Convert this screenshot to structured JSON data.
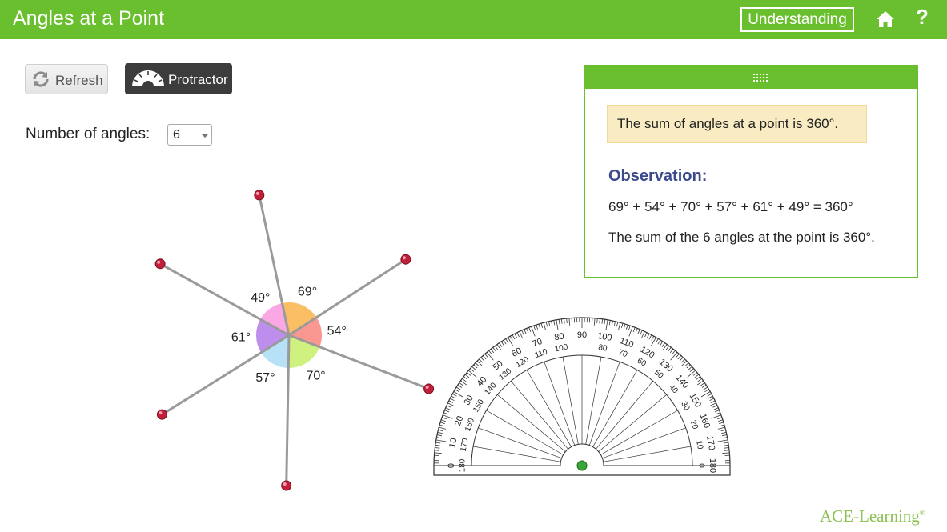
{
  "header": {
    "title": "Angles at a Point",
    "understanding_label": "Understanding",
    "home_icon": "home-icon",
    "help_label": "?"
  },
  "toolbar": {
    "refresh_label": "Refresh",
    "protractor_label": "Protractor"
  },
  "controls": {
    "num_angles_label": "Number of angles:",
    "num_angles_value": "6"
  },
  "diagram": {
    "angles": [
      {
        "label": "69°",
        "value": 69,
        "color": "#f9b44a"
      },
      {
        "label": "54°",
        "value": 54,
        "color": "#f8857e"
      },
      {
        "label": "70°",
        "value": 70,
        "color": "#c5ef6a"
      },
      {
        "label": "57°",
        "value": 57,
        "color": "#a9dcf5"
      },
      {
        "label": "61°",
        "value": 61,
        "color": "#b27ae8"
      },
      {
        "label": "49°",
        "value": 49,
        "color": "#f999df"
      }
    ]
  },
  "observation": {
    "fact": "The sum of angles at a point is 360°.",
    "title": "Observation:",
    "equation": "69° + 54° + 70° + 57° + 61° + 49° = 360°",
    "conclusion": "The sum of the 6 angles at the point is 360°."
  },
  "protractor": {
    "outer_labels": [
      "0",
      "10",
      "20",
      "30",
      "40",
      "50",
      "60",
      "70",
      "80",
      "90",
      "100",
      "110",
      "120",
      "130",
      "140",
      "150",
      "160",
      "170",
      "180"
    ],
    "inner_labels": [
      "180",
      "170",
      "160",
      "150",
      "140",
      "130",
      "120",
      "110",
      "100",
      "80",
      "70",
      "60",
      "50",
      "40",
      "30",
      "20",
      "10",
      "0"
    ]
  },
  "brand": {
    "name": "ACE-Learning",
    "mark": "®"
  },
  "colors": {
    "accent": "#6abf2f",
    "title_blue": "#3c4a8c",
    "fact_bg": "#faecc2",
    "handle": "#c2203a",
    "center_dot": "#3aa63a"
  }
}
